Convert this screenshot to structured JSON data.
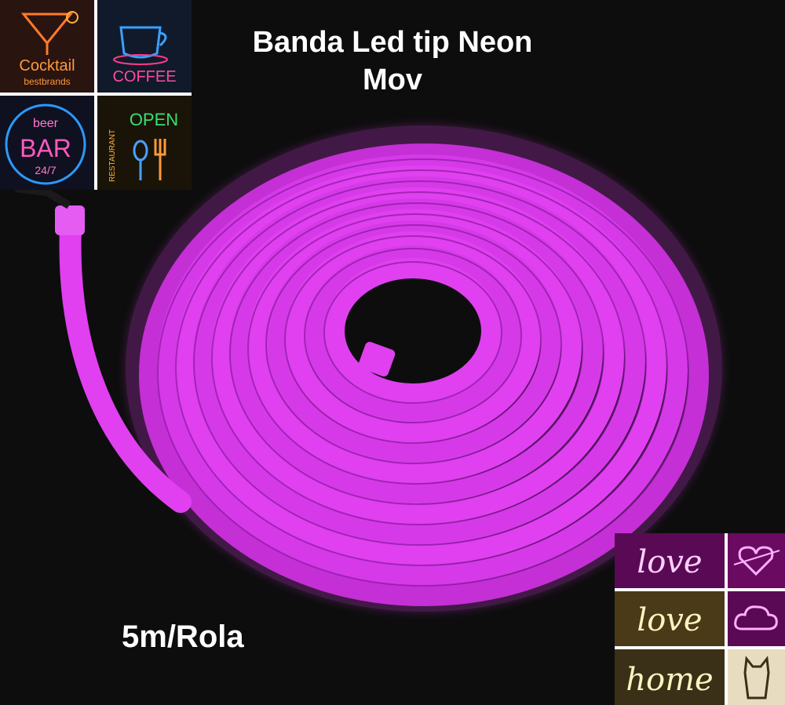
{
  "title_line1": "Banda Led tip Neon",
  "title_line2": "Mov",
  "caption": "5m/Rola",
  "colors": {
    "neon": "#e040f0",
    "neon_dark": "#8a1aa0",
    "background": "#0d0d0d"
  },
  "top_left_tiles": [
    {
      "icon": "cocktail-sign",
      "text": "Cocktail",
      "sub": "bestbrands"
    },
    {
      "icon": "coffee-sign",
      "text": "COFFEE"
    },
    {
      "icon": "beer-bar-sign",
      "text": "BAR",
      "top": "beer",
      "sub": "24/7"
    },
    {
      "icon": "restaurant-open-sign",
      "text": "OPEN",
      "side": "RESTAURANT"
    }
  ],
  "bottom_right_tiles": [
    {
      "icon": "love-pink-sign",
      "text": "love"
    },
    {
      "icon": "heart-arrow-sign"
    },
    {
      "icon": "love-warm-sign",
      "text": "love"
    },
    {
      "icon": "cloud-sign"
    },
    {
      "icon": "home-sign",
      "text": "home"
    },
    {
      "icon": "cat-sign"
    }
  ]
}
